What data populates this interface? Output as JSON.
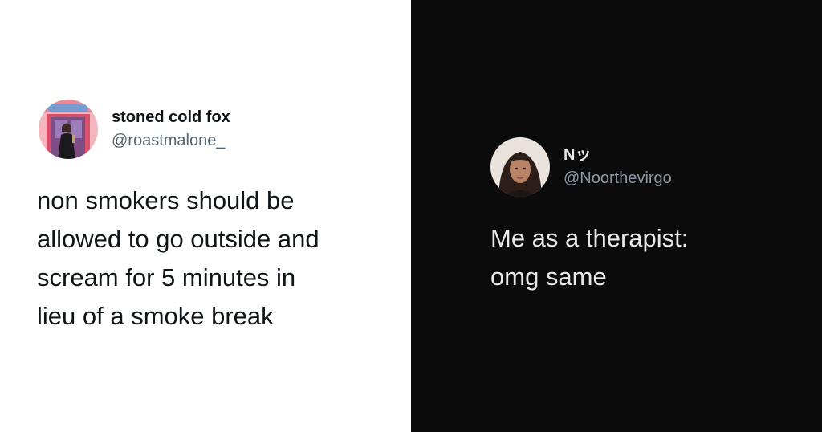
{
  "left_tweet": {
    "display_name": "stoned cold fox",
    "handle": "@roastmalone_",
    "text_lines": [
      "non smokers should be",
      "allowed to go outside and",
      "scream for 5 minutes in",
      "lieu of a smoke break"
    ],
    "avatar_icon": "profile-photo-pink-storefront",
    "background": "#ffffff"
  },
  "right_tweet": {
    "display_name": "Nッ",
    "handle": "@Noorthevirgo",
    "text_lines": [
      "Me as a therapist:",
      "omg same"
    ],
    "avatar_icon": "profile-photo-woman-portrait",
    "background": "#0b0b0c"
  }
}
